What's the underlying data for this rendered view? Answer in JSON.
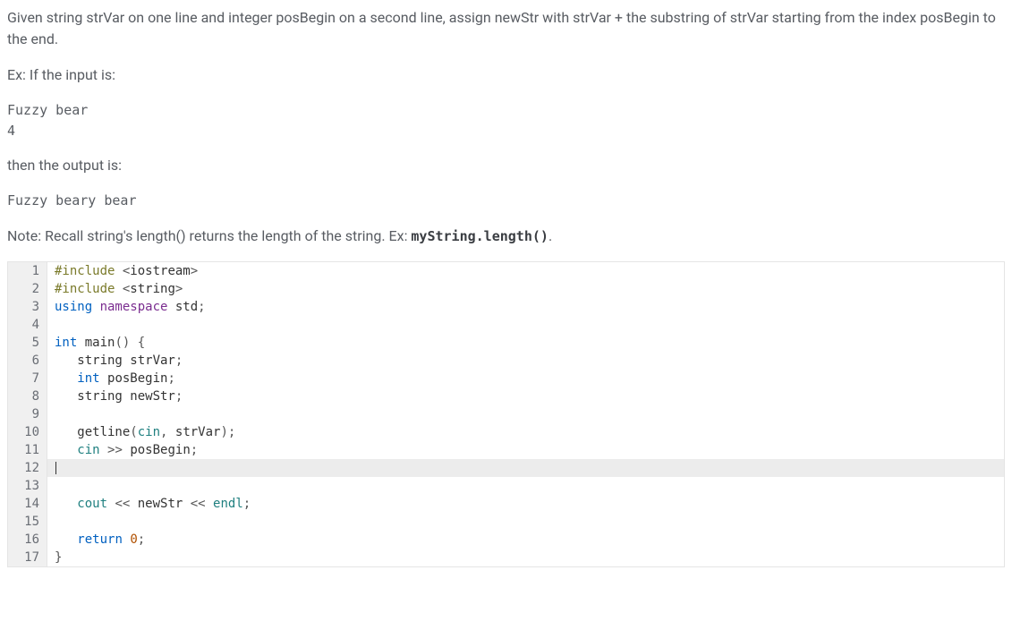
{
  "problem": {
    "description": "Given string strVar on one line and integer posBegin on a second line, assign newStr with strVar + the substring of strVar starting from the index posBegin to the end.",
    "ex_label": "Ex: If the input is:",
    "input_line1": "Fuzzy bear",
    "input_line2": "4",
    "then_label": "then the output is:",
    "output_line": "Fuzzy beary bear",
    "note_prefix": "Note: Recall string's length() returns the length of the string. Ex: ",
    "note_code": "myString.length()",
    "note_suffix": "."
  },
  "code": {
    "lines": [
      {
        "n": "1",
        "tokens": [
          [
            "kw-pre",
            "#include "
          ],
          [
            "punct",
            "<"
          ],
          [
            "ident",
            "iostream"
          ],
          [
            "punct",
            ">"
          ]
        ]
      },
      {
        "n": "2",
        "tokens": [
          [
            "kw-pre",
            "#include "
          ],
          [
            "punct",
            "<"
          ],
          [
            "ident",
            "string"
          ],
          [
            "punct",
            ">"
          ]
        ]
      },
      {
        "n": "3",
        "tokens": [
          [
            "kw-blue",
            "using "
          ],
          [
            "kw-purple",
            "namespace "
          ],
          [
            "ident",
            "std"
          ],
          [
            "punct",
            ";"
          ]
        ]
      },
      {
        "n": "4",
        "tokens": []
      },
      {
        "n": "5",
        "tokens": [
          [
            "kw-blue",
            "int "
          ],
          [
            "ident",
            "main"
          ],
          [
            "punct",
            "() {"
          ]
        ]
      },
      {
        "n": "6",
        "tokens": [
          [
            "ident",
            "   string strVar"
          ],
          [
            "punct",
            ";"
          ]
        ]
      },
      {
        "n": "7",
        "tokens": [
          [
            "ident",
            "   "
          ],
          [
            "kw-blue",
            "int "
          ],
          [
            "ident",
            "posBegin"
          ],
          [
            "punct",
            ";"
          ]
        ]
      },
      {
        "n": "8",
        "tokens": [
          [
            "ident",
            "   string newStr"
          ],
          [
            "punct",
            ";"
          ]
        ]
      },
      {
        "n": "9",
        "tokens": []
      },
      {
        "n": "10",
        "tokens": [
          [
            "ident",
            "   getline"
          ],
          [
            "punct",
            "("
          ],
          [
            "kw-teal",
            "cin"
          ],
          [
            "punct",
            ", "
          ],
          [
            "ident",
            "strVar"
          ],
          [
            "punct",
            ");"
          ]
        ]
      },
      {
        "n": "11",
        "tokens": [
          [
            "ident",
            "   "
          ],
          [
            "kw-teal",
            "cin"
          ],
          [
            "punct",
            " >> "
          ],
          [
            "ident",
            "posBegin"
          ],
          [
            "punct",
            ";"
          ]
        ]
      },
      {
        "n": "12",
        "tokens": [],
        "current": true
      },
      {
        "n": "13",
        "tokens": []
      },
      {
        "n": "14",
        "tokens": [
          [
            "ident",
            "   "
          ],
          [
            "kw-teal",
            "cout"
          ],
          [
            "punct",
            " << "
          ],
          [
            "ident",
            "newStr"
          ],
          [
            "punct",
            " << "
          ],
          [
            "kw-teal",
            "endl"
          ],
          [
            "punct",
            ";"
          ]
        ]
      },
      {
        "n": "15",
        "tokens": []
      },
      {
        "n": "16",
        "tokens": [
          [
            "ident",
            "   "
          ],
          [
            "kw-blue",
            "return "
          ],
          [
            "num",
            "0"
          ],
          [
            "punct",
            ";"
          ]
        ]
      },
      {
        "n": "17",
        "tokens": [
          [
            "punct",
            "}"
          ]
        ]
      }
    ]
  }
}
